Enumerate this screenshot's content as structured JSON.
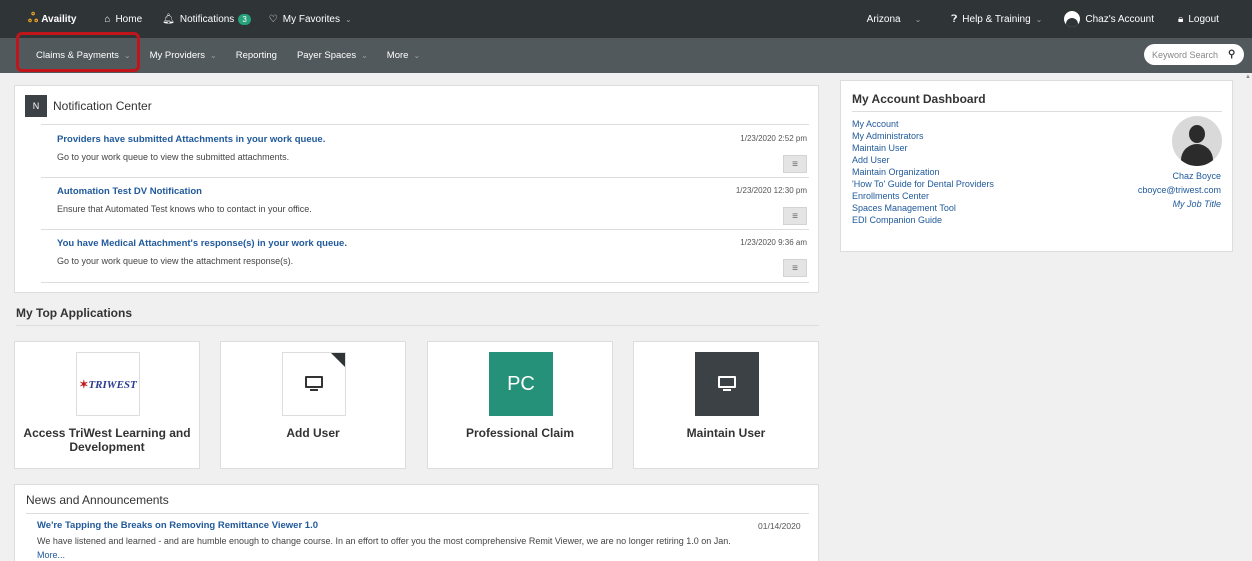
{
  "topbar": {
    "logo": "Availity",
    "home": "Home",
    "notifications": "Notifications",
    "notifications_count": "3",
    "favorites": "My Favorites",
    "region": "Arizona",
    "help": "Help & Training",
    "account": "Chaz's Account",
    "logout": "Logout"
  },
  "navbar": {
    "items": [
      "Claims & Payments",
      "My Providers",
      "Reporting",
      "Payer Spaces",
      "More"
    ],
    "search_placeholder": "Keyword Search"
  },
  "notification_center": {
    "icon_letter": "N",
    "title": "Notification Center",
    "items": [
      {
        "title": "Providers have submitted Attachments in your work queue.",
        "subtitle": "Go to your work queue to view the submitted attachments.",
        "time": "1/23/2020 2:52 pm"
      },
      {
        "title": "Automation Test DV Notification",
        "subtitle": "Ensure that Automated Test knows who to contact in your office.",
        "time": "1/23/2020 12:30 pm"
      },
      {
        "title": "You have Medical Attachment's response(s) in your work queue.",
        "subtitle": "Go to your work queue to view the attachment response(s).",
        "time": "1/23/2020 9:36 am"
      }
    ],
    "menu_glyph": "≡"
  },
  "top_apps": {
    "title": "My Top Applications",
    "apps": [
      {
        "label": "Access TriWest Learning and Development",
        "logo_text": "TRIWEST"
      },
      {
        "label": "Add User"
      },
      {
        "label": "Professional Claim",
        "icon_text": "PC"
      },
      {
        "label": "Maintain User"
      }
    ]
  },
  "news": {
    "title": "News and Announcements",
    "item_title": "We're Tapping the Breaks on Removing Remittance Viewer 1.0",
    "item_date": "01/14/2020",
    "item_body": "We have listened and learned - and are humble enough to change course. In an effort to offer you the most comprehensive Remit Viewer, we are no longer retiring 1.0 on Jan.",
    "more": "More..."
  },
  "dashboard": {
    "title": "My Account Dashboard",
    "links": [
      "My Account",
      "My Administrators",
      "Maintain User",
      "Add User",
      "Maintain Organization",
      "'How To' Guide for Dental Providers",
      "Enrollments Center",
      "Spaces Management Tool",
      "EDI Companion Guide"
    ],
    "name": "Chaz Boyce",
    "email": "cboyce@triwest.com",
    "job_title": "My Job Title"
  },
  "colors": {
    "topbar": "#2f3437",
    "navbar": "#52595d",
    "link": "#215a9b",
    "highlight": "#c0151b",
    "pc_tile": "#249178"
  }
}
